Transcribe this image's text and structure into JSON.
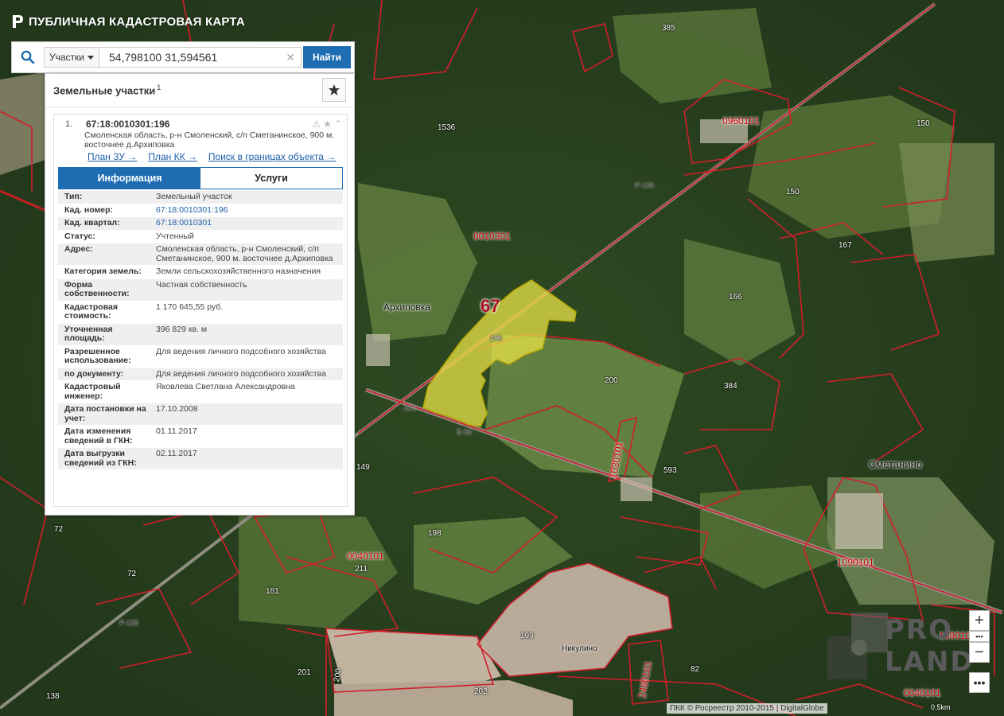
{
  "header": {
    "title": "ПУБЛИЧНАЯ КАДАСТРОВАЯ КАРТА"
  },
  "search": {
    "type_label": "Участки",
    "query": "54,798100 31,594561",
    "button_label": "Найти"
  },
  "panel": {
    "title": "Земельные участки",
    "count": "1",
    "item": {
      "index": "1.",
      "number": "67:18:0010301:196",
      "address": "Смоленская область, р-н Смоленский, с/п Сметанинское, 900 м. восточнее д.Архиповка",
      "links": [
        "План ЗУ →",
        "План КК →",
        "Поиск в границах объекта →"
      ],
      "tabs": [
        "Информация",
        "Услуги"
      ],
      "rows": [
        {
          "key": "Тип:",
          "value": "Земельный участок"
        },
        {
          "key": "Кад. номер:",
          "value": "67:18:0010301:196"
        },
        {
          "key": "Кад. квартал:",
          "value": "67:18:0010301"
        },
        {
          "key": "Статус:",
          "value": "Учтенный"
        },
        {
          "key": "Адрес:",
          "value": "Смоленская область, р-н Смоленский, с/п Сметанинское, 900 м. восточнее д.Архиповка"
        },
        {
          "key": "Категория земель:",
          "value": "Земли сельскохозяйственного назначения"
        },
        {
          "key": "Форма собственности:",
          "value": "Частная собственность"
        },
        {
          "key": "Кадастровая стоимость:",
          "value": "1 170 645,55 руб."
        },
        {
          "key": "Уточненная площадь:",
          "value": "396 829 кв. м"
        },
        {
          "key": "Разрешенное использование:",
          "value": "Для ведения личного подсобного хозяйства"
        },
        {
          "key": "по документу:",
          "value": "Для ведения личного подсобного хозяйства"
        },
        {
          "key": "Кадастровый инженер:",
          "value": "Яковлева Светлана Александровна"
        },
        {
          "key": "Дата постановки на учет:",
          "value": "17.10.2008"
        },
        {
          "key": "Дата изменения сведений в ГКН:",
          "value": "01.11.2017"
        },
        {
          "key": "Дата выгрузки сведений из ГКН:",
          "value": "02.11.2017"
        }
      ]
    }
  },
  "map": {
    "region_label": "67",
    "parcel_label": "196",
    "quarter_labels": [
      "0010301",
      "0960101",
      "1030101",
      "0040101",
      "1090101",
      "2480101",
      "0040101",
      "1090101"
    ],
    "parcel_labels": [
      "385",
      "1536",
      "150",
      "150",
      "167",
      "166",
      "200",
      "384",
      "593",
      "149",
      "72",
      "72",
      "198",
      "211",
      "181",
      "199",
      "201",
      "200",
      "202",
      "82",
      "138"
    ],
    "village_labels": [
      "Архиповка",
      "Сметанино",
      "Никулино"
    ],
    "road_labels": [
      "Р-135",
      "201",
      "Р-135",
      "Е-30"
    ],
    "attribution": "ПКК © Росреестр 2010-2015 | DigitalGlobe",
    "scale": "0.5km",
    "watermark": "PRO LAND"
  },
  "colors": {
    "accent": "#1e6db3",
    "parcel_highlight": "#e8e34a",
    "boundary": "#d21e2a"
  },
  "zoom": {
    "in": "+",
    "out": "−",
    "more": "•••"
  }
}
